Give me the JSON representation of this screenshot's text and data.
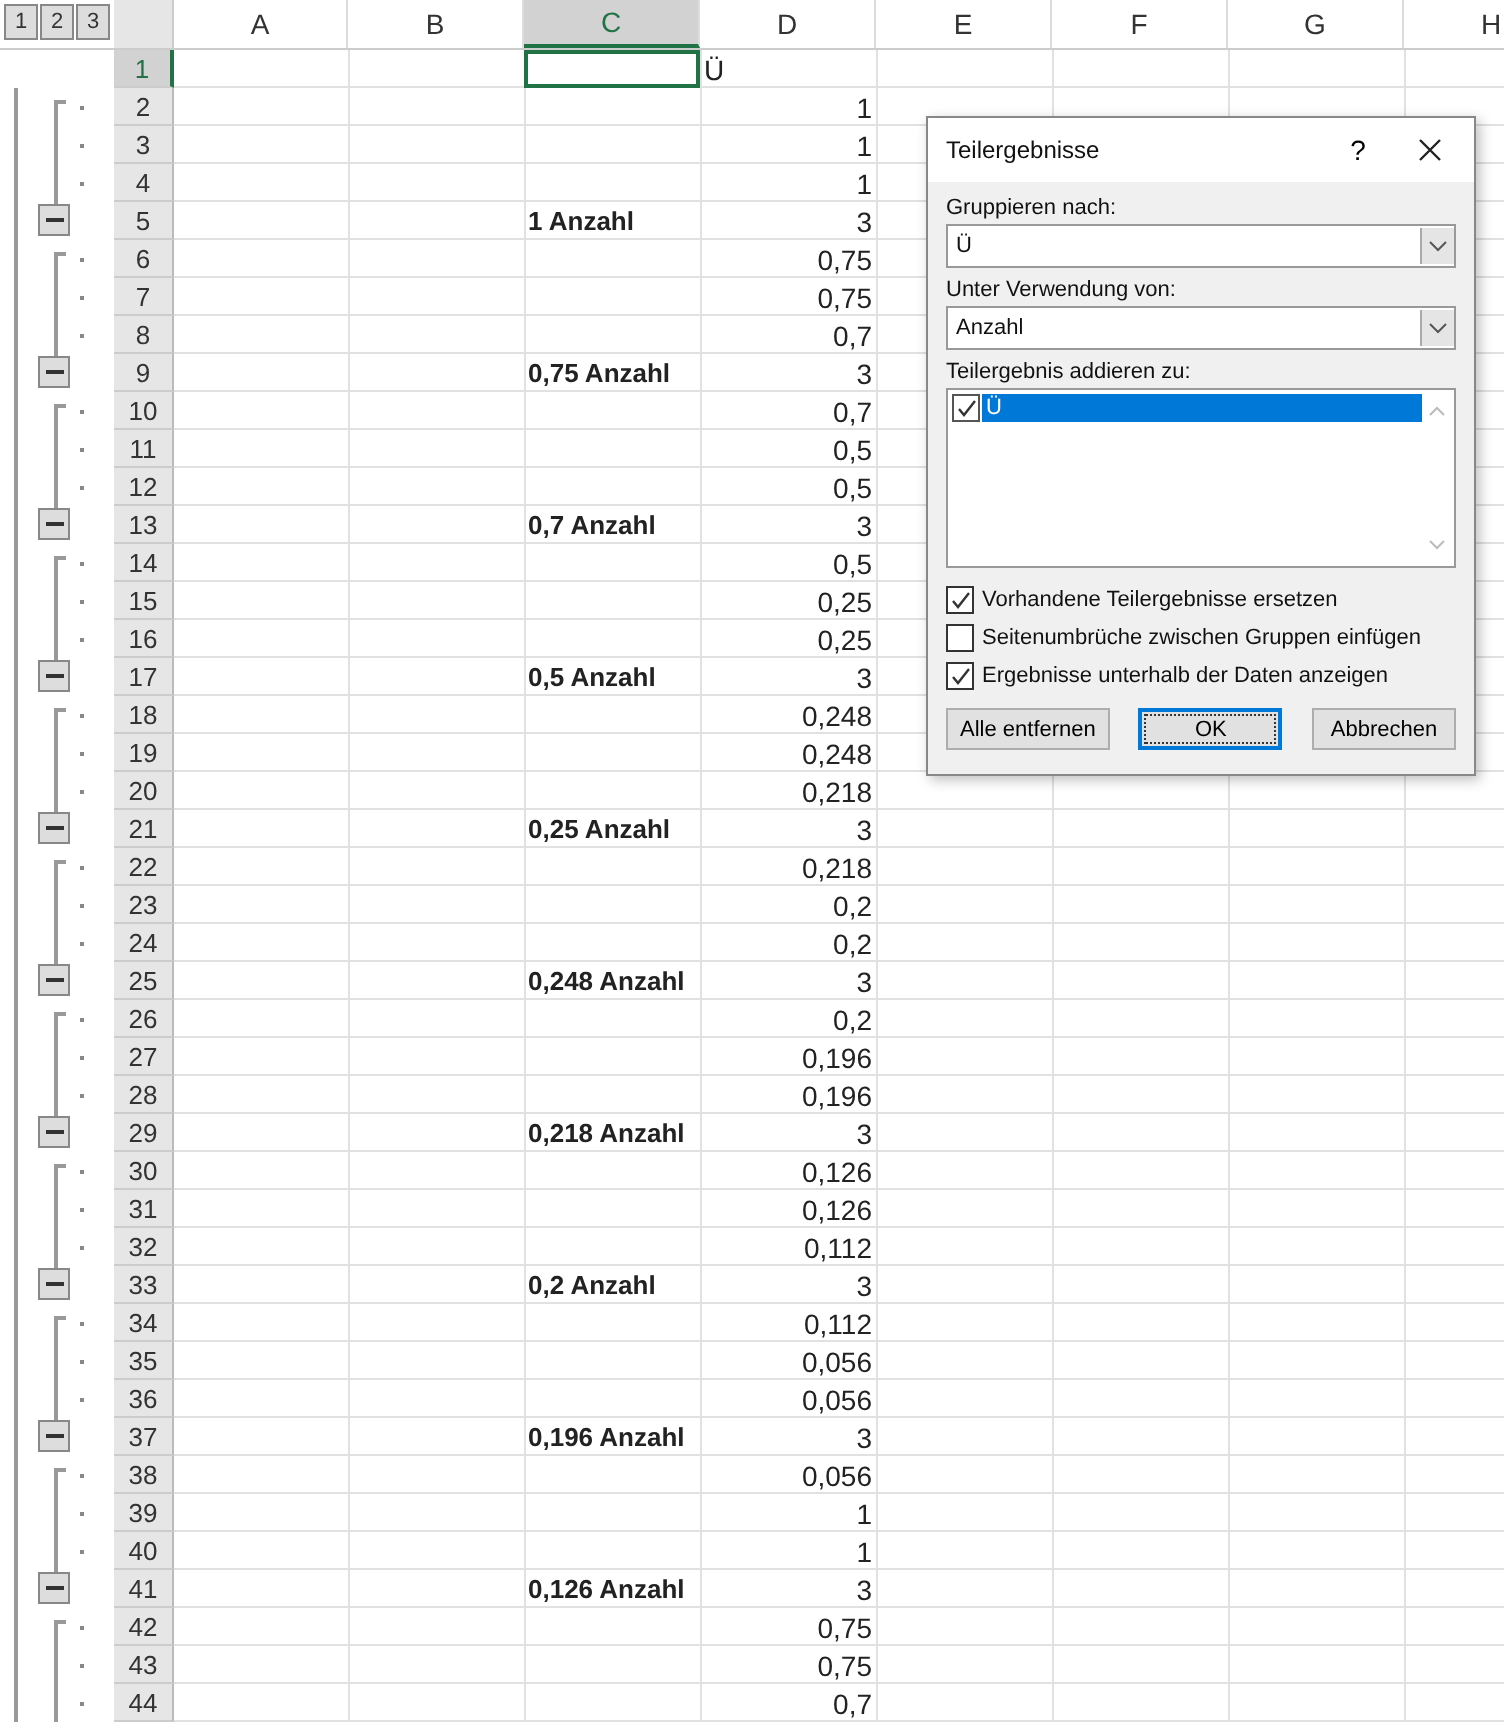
{
  "outline_levels": [
    "1",
    "2",
    "3"
  ],
  "columns": [
    {
      "label": "A",
      "selected": false
    },
    {
      "label": "B",
      "selected": false
    },
    {
      "label": "C",
      "selected": true
    },
    {
      "label": "D",
      "selected": false
    },
    {
      "label": "E",
      "selected": false
    },
    {
      "label": "F",
      "selected": false
    },
    {
      "label": "G",
      "selected": false
    },
    {
      "label": "H",
      "selected": false
    }
  ],
  "rows": [
    {
      "number": "1",
      "kind": "header",
      "selected": true,
      "d": "Ü"
    },
    {
      "number": "2",
      "kind": "detail",
      "selected": false,
      "d": "1"
    },
    {
      "number": "3",
      "kind": "detail",
      "selected": false,
      "d": "1"
    },
    {
      "number": "4",
      "kind": "detail",
      "selected": false,
      "d": "1"
    },
    {
      "number": "5",
      "kind": "subtotal",
      "selected": false,
      "c": "1 Anzahl",
      "d": "3"
    },
    {
      "number": "6",
      "kind": "detail",
      "selected": false,
      "d": "0,75"
    },
    {
      "number": "7",
      "kind": "detail",
      "selected": false,
      "d": "0,75"
    },
    {
      "number": "8",
      "kind": "detail",
      "selected": false,
      "d": "0,7"
    },
    {
      "number": "9",
      "kind": "subtotal",
      "selected": false,
      "c": "0,75 Anzahl",
      "d": "3"
    },
    {
      "number": "10",
      "kind": "detail",
      "selected": false,
      "d": "0,7"
    },
    {
      "number": "11",
      "kind": "detail",
      "selected": false,
      "d": "0,5"
    },
    {
      "number": "12",
      "kind": "detail",
      "selected": false,
      "d": "0,5"
    },
    {
      "number": "13",
      "kind": "subtotal",
      "selected": false,
      "c": "0,7 Anzahl",
      "d": "3"
    },
    {
      "number": "14",
      "kind": "detail",
      "selected": false,
      "d": "0,5"
    },
    {
      "number": "15",
      "kind": "detail",
      "selected": false,
      "d": "0,25"
    },
    {
      "number": "16",
      "kind": "detail",
      "selected": false,
      "d": "0,25"
    },
    {
      "number": "17",
      "kind": "subtotal",
      "selected": false,
      "c": "0,5 Anzahl",
      "d": "3"
    },
    {
      "number": "18",
      "kind": "detail",
      "selected": false,
      "d": "0,248"
    },
    {
      "number": "19",
      "kind": "detail",
      "selected": false,
      "d": "0,248"
    },
    {
      "number": "20",
      "kind": "detail",
      "selected": false,
      "d": "0,218"
    },
    {
      "number": "21",
      "kind": "subtotal",
      "selected": false,
      "c": "0,25 Anzahl",
      "d": "3"
    },
    {
      "number": "22",
      "kind": "detail",
      "selected": false,
      "d": "0,218"
    },
    {
      "number": "23",
      "kind": "detail",
      "selected": false,
      "d": "0,2"
    },
    {
      "number": "24",
      "kind": "detail",
      "selected": false,
      "d": "0,2"
    },
    {
      "number": "25",
      "kind": "subtotal",
      "selected": false,
      "c": "0,248 Anzahl",
      "d": "3"
    },
    {
      "number": "26",
      "kind": "detail",
      "selected": false,
      "d": "0,2"
    },
    {
      "number": "27",
      "kind": "detail",
      "selected": false,
      "d": "0,196"
    },
    {
      "number": "28",
      "kind": "detail",
      "selected": false,
      "d": "0,196"
    },
    {
      "number": "29",
      "kind": "subtotal",
      "selected": false,
      "c": "0,218 Anzahl",
      "d": "3"
    },
    {
      "number": "30",
      "kind": "detail",
      "selected": false,
      "d": "0,126"
    },
    {
      "number": "31",
      "kind": "detail",
      "selected": false,
      "d": "0,126"
    },
    {
      "number": "32",
      "kind": "detail",
      "selected": false,
      "d": "0,112"
    },
    {
      "number": "33",
      "kind": "subtotal",
      "selected": false,
      "c": "0,2 Anzahl",
      "d": "3"
    },
    {
      "number": "34",
      "kind": "detail",
      "selected": false,
      "d": "0,112"
    },
    {
      "number": "35",
      "kind": "detail",
      "selected": false,
      "d": "0,056"
    },
    {
      "number": "36",
      "kind": "detail",
      "selected": false,
      "d": "0,056"
    },
    {
      "number": "37",
      "kind": "subtotal",
      "selected": false,
      "c": "0,196 Anzahl",
      "d": "3"
    },
    {
      "number": "38",
      "kind": "detail",
      "selected": false,
      "d": "0,056"
    },
    {
      "number": "39",
      "kind": "detail",
      "selected": false,
      "d": "1"
    },
    {
      "number": "40",
      "kind": "detail",
      "selected": false,
      "d": "1"
    },
    {
      "number": "41",
      "kind": "subtotal",
      "selected": false,
      "c": "0,126 Anzahl",
      "d": "3"
    },
    {
      "number": "42",
      "kind": "detail",
      "selected": false,
      "d": "0,75"
    },
    {
      "number": "43",
      "kind": "detail",
      "selected": false,
      "d": "0,75"
    },
    {
      "number": "44",
      "kind": "detail",
      "selected": false,
      "d": "0,7"
    }
  ],
  "dialog": {
    "title": "Teilergebnisse",
    "help": "?",
    "group_by": {
      "label": "Gruppieren nach:",
      "value": "Ü"
    },
    "function": {
      "label": "Unter Verwendung von:",
      "value": "Anzahl"
    },
    "add_to": {
      "label": "Teilergebnis addieren zu:",
      "items": [
        {
          "label": "Ü",
          "checked": true,
          "selected": true
        }
      ]
    },
    "options": [
      {
        "label": "Vorhandene Teilergebnisse ersetzen",
        "checked": true
      },
      {
        "label": "Seitenumbrüche zwischen Gruppen einfügen",
        "checked": false
      },
      {
        "label": "Ergebnisse unterhalb der Daten anzeigen",
        "checked": true
      }
    ],
    "buttons": [
      {
        "label": "Alle entfernen",
        "default": false
      },
      {
        "label": "OK",
        "default": true
      },
      {
        "label": "Abbrechen",
        "default": false
      }
    ]
  }
}
